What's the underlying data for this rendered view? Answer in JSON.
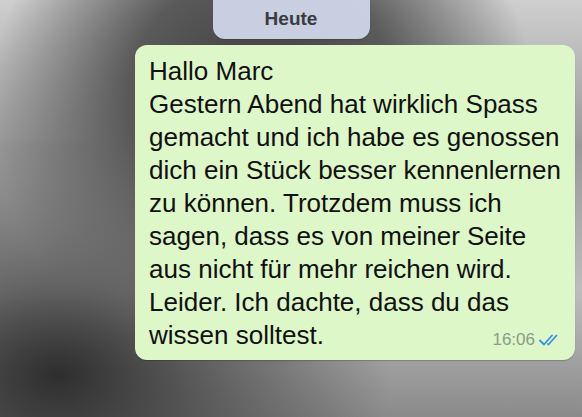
{
  "date_label": "Heute",
  "messages": [
    {
      "lines": [
        "Hallo Marc",
        "Gestern Abend hat wirklich Spass",
        "gemacht und ich habe es genossen",
        "dich ein Stück besser kennenlernen",
        "zu können. Trotzdem muss ich",
        "sagen, dass es von meiner Seite",
        "aus nicht für mehr reichen wird.",
        "Leider. Ich dachte, dass du das",
        "wissen solltest."
      ],
      "time": "16:06",
      "outgoing": true,
      "read": true
    }
  ]
}
